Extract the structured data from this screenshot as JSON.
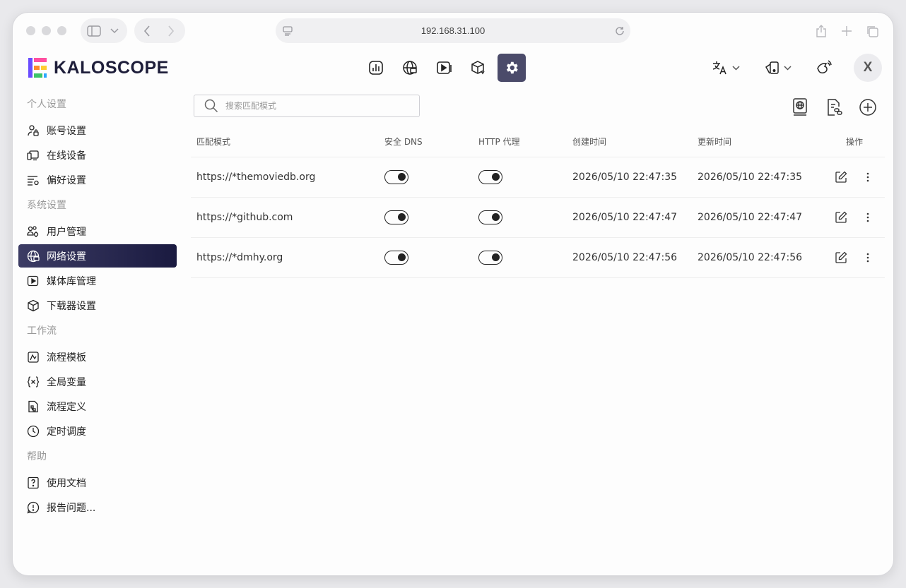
{
  "browser": {
    "url": "192.168.31.100"
  },
  "app": {
    "logo_text": "KALOSCOPE",
    "avatar_letter": "X"
  },
  "topnav": [
    {
      "name": "dashboard",
      "icon": "chart-icon"
    },
    {
      "name": "network",
      "icon": "globe-icon"
    },
    {
      "name": "media",
      "icon": "play-icon"
    },
    {
      "name": "downloader",
      "icon": "box-icon"
    },
    {
      "name": "settings",
      "icon": "gear-icon",
      "active": true
    }
  ],
  "sidebar": {
    "sections": [
      {
        "title": "个人设置",
        "items": [
          {
            "label": "账号设置",
            "icon": "user-lock-icon"
          },
          {
            "label": "在线设备",
            "icon": "devices-icon"
          },
          {
            "label": "偏好设置",
            "icon": "list-settings-icon"
          }
        ]
      },
      {
        "title": "系统设置",
        "items": [
          {
            "label": "用户管理",
            "icon": "users-gear-icon"
          },
          {
            "label": "网络设置",
            "icon": "globe-icon",
            "active": true
          },
          {
            "label": "媒体库管理",
            "icon": "play-icon"
          },
          {
            "label": "下载器设置",
            "icon": "box-icon"
          }
        ]
      },
      {
        "title": "工作流",
        "items": [
          {
            "label": "流程模板",
            "icon": "template-icon"
          },
          {
            "label": "全局变量",
            "icon": "variable-icon"
          },
          {
            "label": "流程定义",
            "icon": "file-flow-icon"
          },
          {
            "label": "定时调度",
            "icon": "clock-icon"
          }
        ]
      },
      {
        "title": "帮助",
        "items": [
          {
            "label": "使用文档",
            "icon": "help-doc-icon"
          },
          {
            "label": "报告问题...",
            "icon": "alert-icon"
          }
        ]
      }
    ]
  },
  "main": {
    "search_placeholder": "搜索匹配模式",
    "columns": {
      "pattern": "匹配模式",
      "dns": "安全 DNS",
      "proxy": "HTTP 代理",
      "created": "创建时间",
      "updated": "更新时间",
      "actions": "操作"
    },
    "rows": [
      {
        "pattern": "https://*themoviedb.org",
        "dns": true,
        "proxy": true,
        "created": "2026/05/10 22:47:35",
        "updated": "2026/05/10 22:47:35"
      },
      {
        "pattern": "https://*github.com",
        "dns": true,
        "proxy": true,
        "created": "2026/05/10 22:47:47",
        "updated": "2026/05/10 22:47:47"
      },
      {
        "pattern": "https://*dmhy.org",
        "dns": true,
        "proxy": true,
        "created": "2026/05/10 22:47:56",
        "updated": "2026/05/10 22:47:56"
      }
    ]
  }
}
